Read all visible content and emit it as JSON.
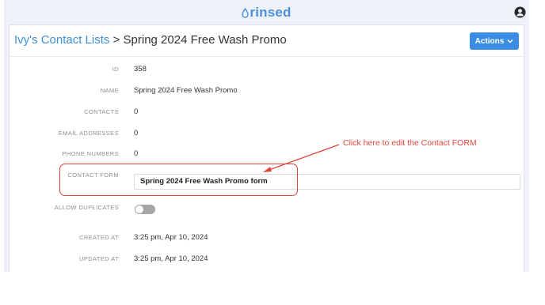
{
  "app": {
    "logo_text": "rinsed"
  },
  "header": {
    "breadcrumb_link": "Ivy's Contact Lists",
    "breadcrumb_sep": ">",
    "breadcrumb_current": "Spring 2024 Free Wash Promo",
    "actions_label": "Actions"
  },
  "fields": {
    "id": {
      "label": "ID",
      "value": "358"
    },
    "name": {
      "label": "NAME",
      "value": "Spring 2024 Free Wash Promo"
    },
    "contacts": {
      "label": "CONTACTS",
      "value": "0"
    },
    "email_addresses": {
      "label": "EMAIL ADDRESSES",
      "value": "0"
    },
    "phone_numbers": {
      "label": "PHONE NUMBERS",
      "value": "0"
    },
    "contact_form": {
      "label": "CONTACT FORM",
      "value": "Spring 2024 Free Wash Promo form"
    },
    "allow_duplicates": {
      "label": "ALLOW DUPLICATES",
      "enabled": false
    },
    "created_at": {
      "label": "CREATED AT",
      "value": "3:25 pm, Apr 10, 2024"
    },
    "updated_at": {
      "label": "UPDATED AT",
      "value": "3:25 pm, Apr 10, 2024"
    }
  },
  "annotation": {
    "text": "Click here to edit the Contact FORM",
    "color": "#e0443a"
  },
  "colors": {
    "brand": "#4a90d9",
    "button": "#3a8ee6",
    "link": "#3d8fd6"
  }
}
